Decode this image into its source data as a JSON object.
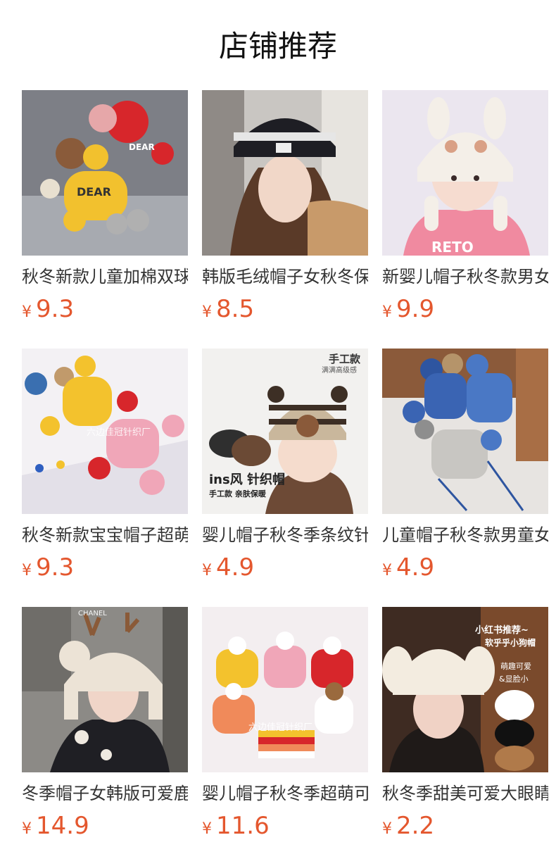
{
  "section_title": "店铺推荐",
  "currency": "¥",
  "products": [
    {
      "name": "秋冬新款儿童加棉双球毛线帽",
      "price": "9.3"
    },
    {
      "name": "韩版毛绒帽子女秋冬保暖针织帽",
      "price": "8.5"
    },
    {
      "name": "新婴儿帽子秋冬款男女宝宝护耳帽",
      "price": "9.9"
    },
    {
      "name": "秋冬新款宝宝帽子超萌可爱毛线帽",
      "price": "9.3"
    },
    {
      "name": "婴儿帽子秋冬季条纹针织护耳帽",
      "price": "4.9"
    },
    {
      "name": "儿童帽子秋冬款男童女童护耳帽",
      "price": "4.9"
    },
    {
      "name": "冬季帽子女韩版可爱鹿角雷锋帽",
      "price": "14.9"
    },
    {
      "name": "婴儿帽子秋冬季超萌可爱针织帽",
      "price": "11.6"
    },
    {
      "name": "秋冬季甜美可爱大眼睛毛绒帽",
      "price": "2.2"
    }
  ],
  "image_text": {
    "watermark": "六边佳冠针织厂",
    "handmade_badge": "手工款",
    "handmade_sub": "满满高级感",
    "ins_title": "ins风 针织帽",
    "ins_sub": "手工款 亲肤保暖",
    "rec_title": "小红书推荐~",
    "rec_sub": "软乎乎小狗帽",
    "rec_cute": "萌趣可爱",
    "rec_face": "&显脸小",
    "dear": "DEAR",
    "chanel": "CHANEL",
    "reto": "RETO"
  }
}
